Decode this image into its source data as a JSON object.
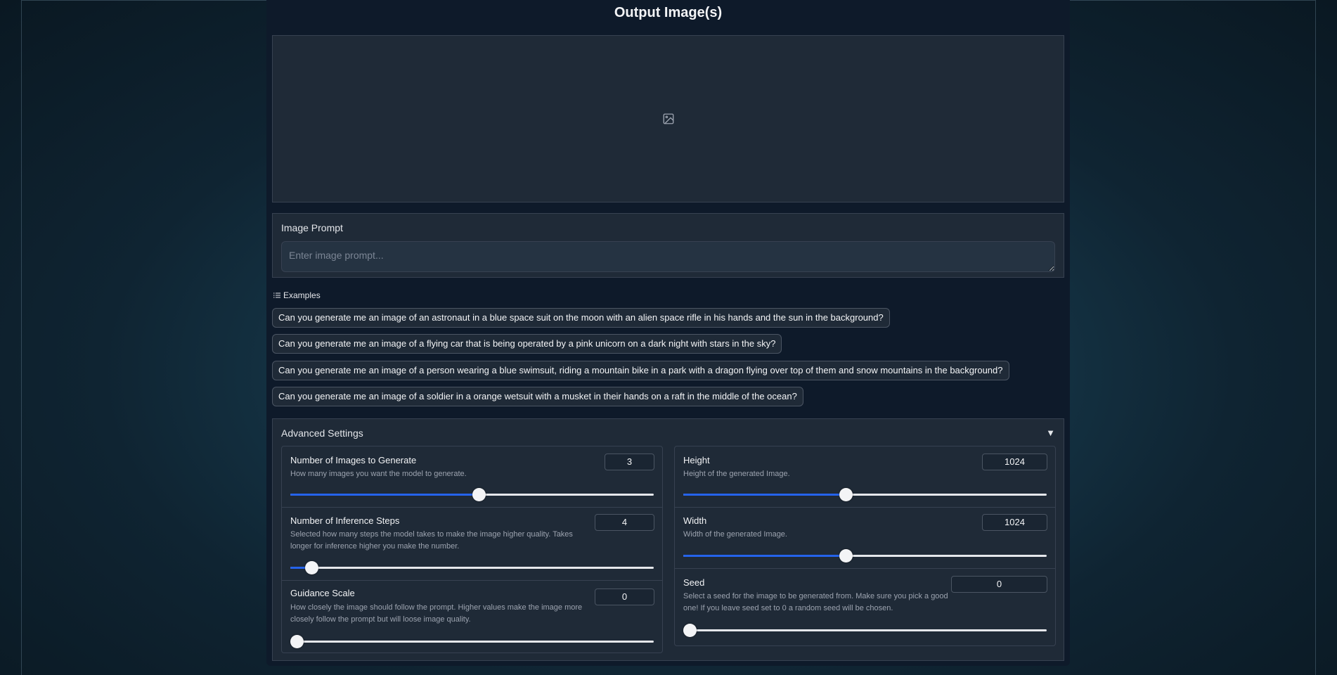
{
  "page": {
    "title": "Output Image(s)"
  },
  "output": {
    "icon": "image-placeholder-icon"
  },
  "prompt": {
    "label": "Image Prompt",
    "placeholder": "Enter image prompt...",
    "value": ""
  },
  "examples": {
    "header": "Examples",
    "items": [
      "Can you generate me an image of an astronaut in a blue space suit on the moon with an alien space rifle in his hands and the sun in the background?",
      "Can you generate me an image of a flying car that is being operated by a pink unicorn on a dark night with stars in the sky?",
      "Can you generate me an image of a person wearing a blue swimsuit, riding a mountain bike in a park with a dragon flying over top of them and snow mountains in the background?",
      "Can you generate me an image of a soldier in a orange wetsuit with a musket in their hands on a raft in the middle of the ocean?"
    ]
  },
  "advanced": {
    "title": "Advanced Settings",
    "toggle": "▼",
    "settings": {
      "num_images": {
        "label": "Number of Images to Generate",
        "desc": "How many images you want the model to generate.",
        "value": "3",
        "fraction": 0.5
      },
      "steps": {
        "label": "Number of Inference Steps",
        "desc": "Selected how many steps the model takes to make the image higher quality. Takes longer for inference higher you make the number.",
        "value": "4",
        "fraction": 0.04
      },
      "guidance": {
        "label": "Guidance Scale",
        "desc": "How closely the image should follow the prompt. Higher values make the image more closely follow the prompt but will loose image quality.",
        "value": "0",
        "fraction": 0.0
      },
      "height": {
        "label": "Height",
        "desc": "Height of the generated Image.",
        "value": "1024",
        "fraction": 0.43
      },
      "width": {
        "label": "Width",
        "desc": "Width of the generated Image.",
        "value": "1024",
        "fraction": 0.43
      },
      "seed": {
        "label": "Seed",
        "desc": "Select a seed for the image to be generated from. Make sure you pick a good one! If you leave seed set to 0 a random seed will be chosen.",
        "value": "0",
        "fraction": 0.0
      }
    }
  },
  "colors": {
    "accent": "#2563eb",
    "panel": "#1f2a37",
    "border": "#374151"
  }
}
